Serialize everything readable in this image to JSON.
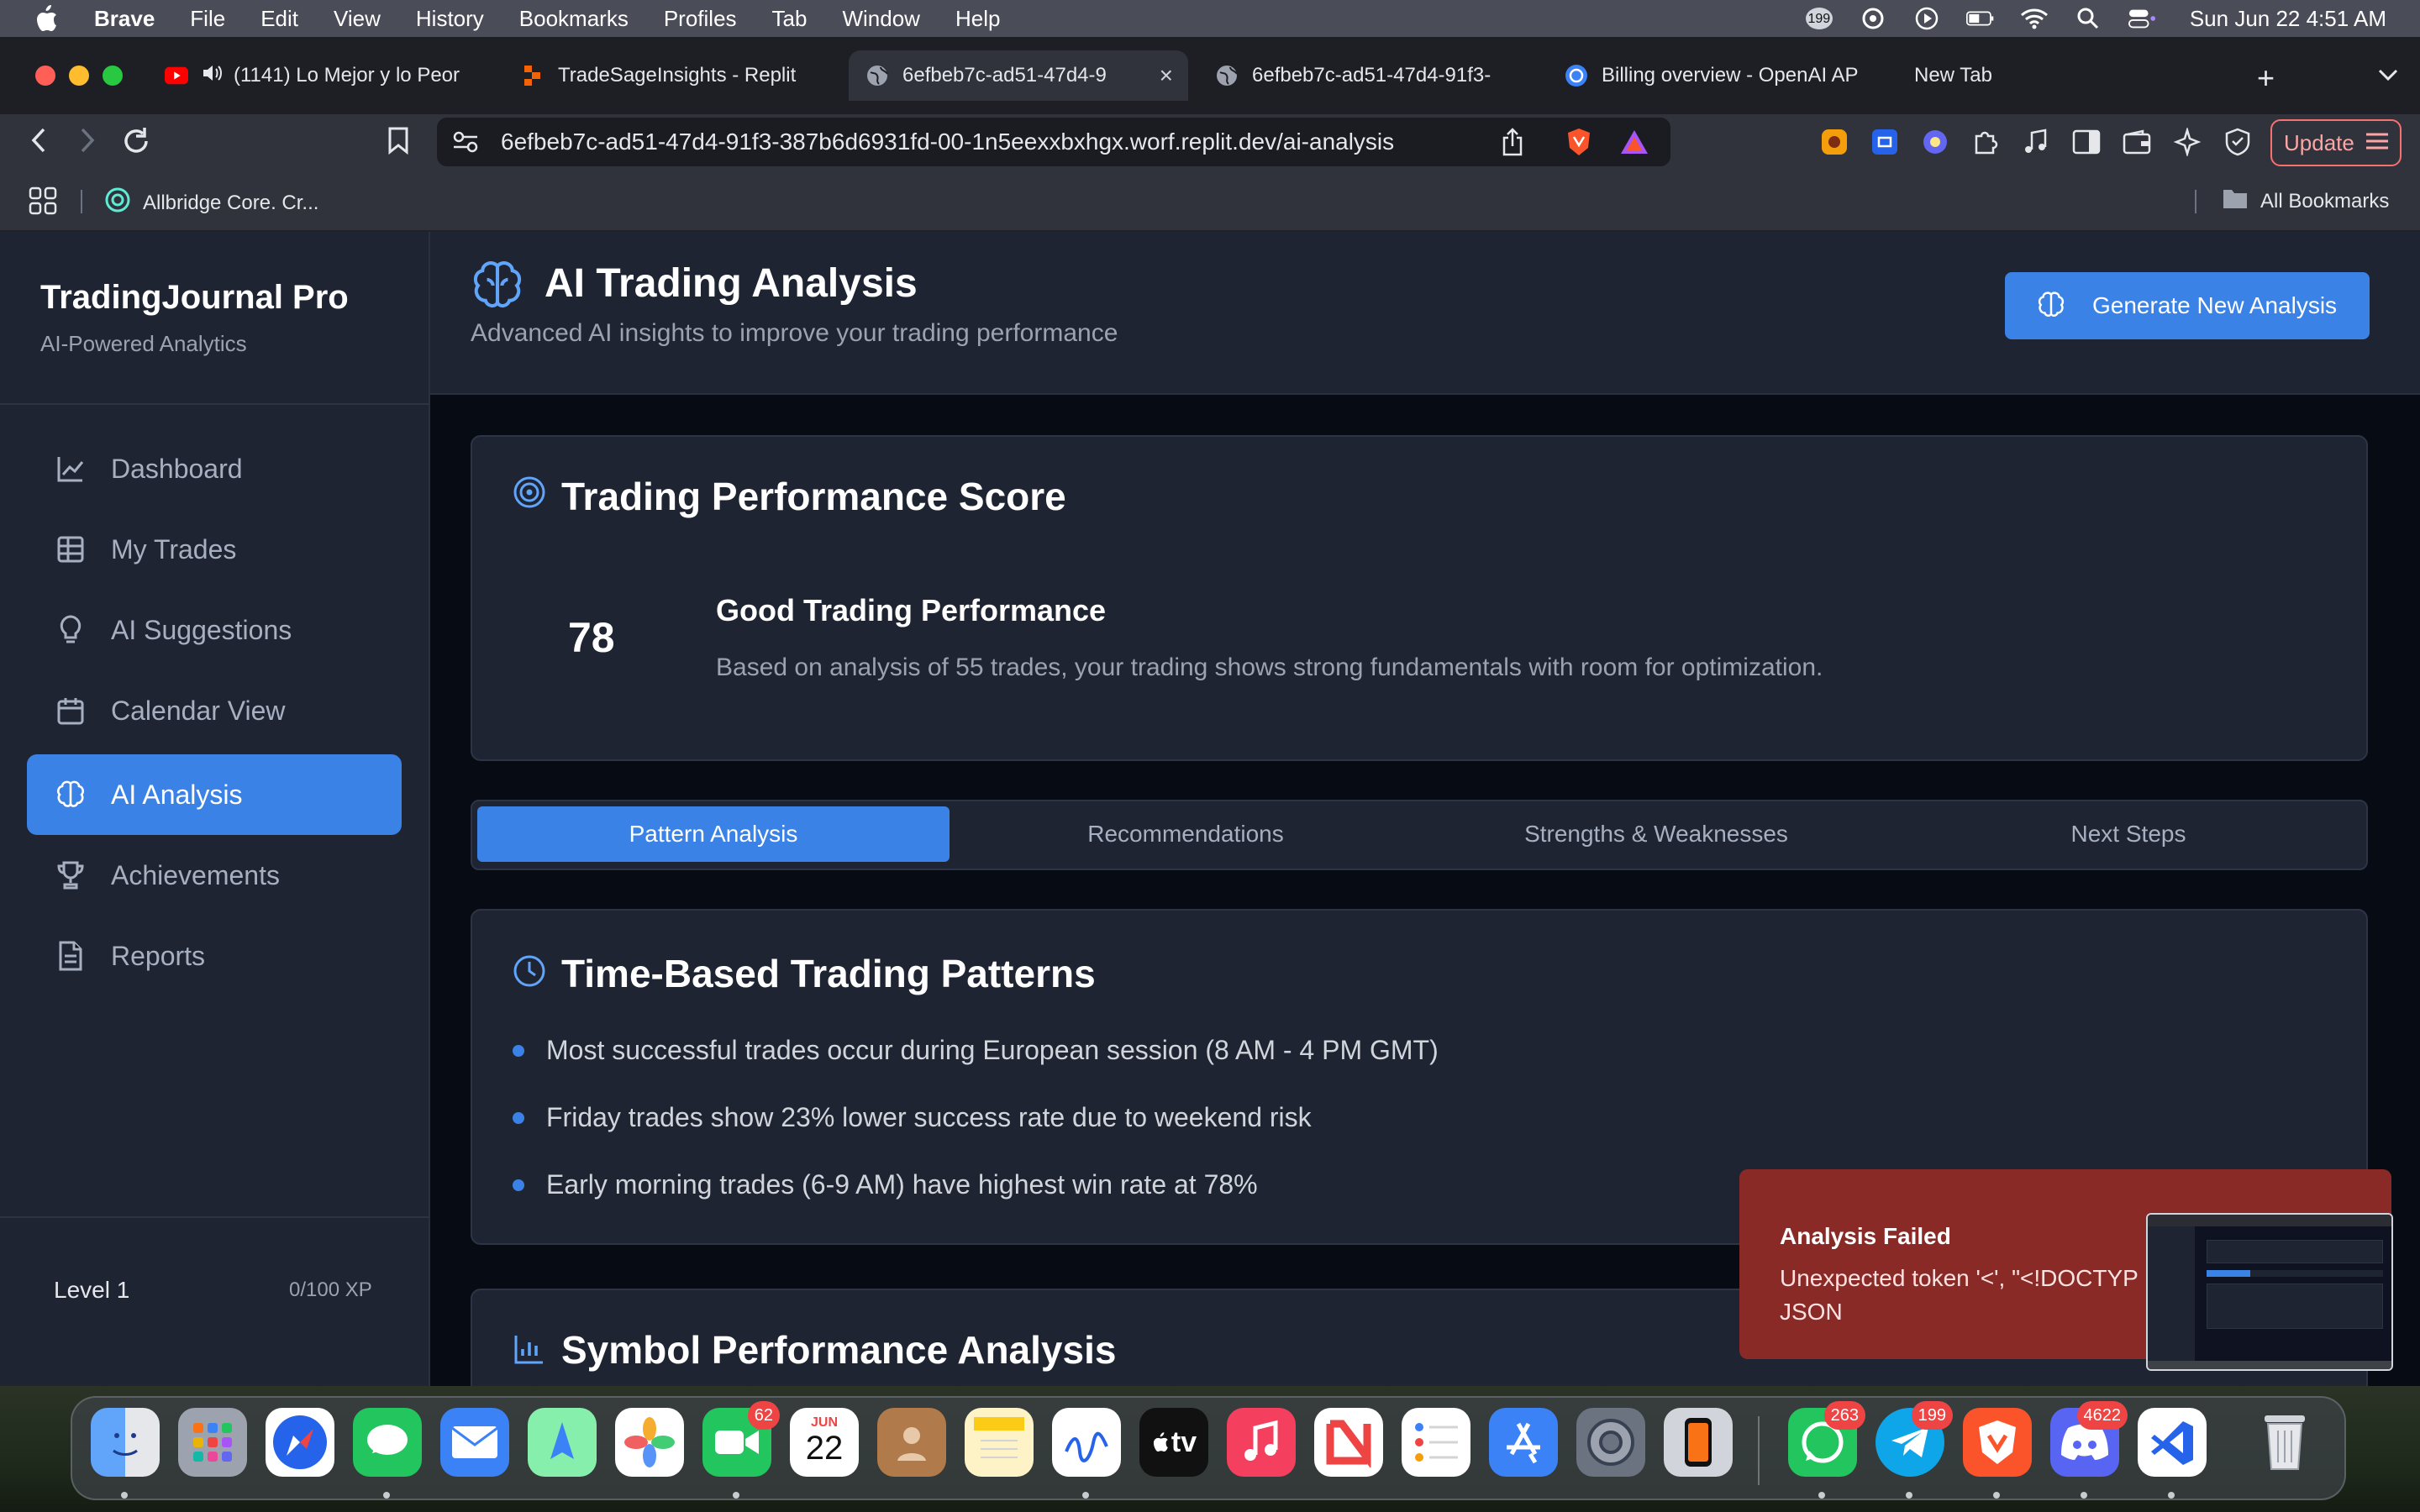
{
  "menubar": {
    "app_name": "Brave",
    "menus": [
      "File",
      "Edit",
      "View",
      "History",
      "Bookmarks",
      "Profiles",
      "Tab",
      "Window",
      "Help"
    ],
    "notif_count": "199",
    "clock": "Sun Jun 22  4:51 AM"
  },
  "browser": {
    "tabs": [
      {
        "title": "(1141) Lo Mejor y lo Peor",
        "icon": "youtube-icon"
      },
      {
        "title": "TradeSageInsights - Replit",
        "icon": "replit-icon"
      },
      {
        "title": "6efbeb7c-ad51-47d4-9",
        "icon": "globe-icon",
        "active": true
      },
      {
        "title": "6efbeb7c-ad51-47d4-91f3-",
        "icon": "globe-icon"
      },
      {
        "title": "Billing overview - OpenAI AP",
        "icon": "openai-icon"
      },
      {
        "title": "New Tab",
        "icon": ""
      }
    ],
    "url": "6efbeb7c-ad51-47d4-91f3-387b6d6931fd-00-1n5eexxbxhgx.worf.replit.dev/ai-analysis",
    "update_label": "Update",
    "bookmark_folder": "Allbridge Core. Cr...",
    "all_bookmarks": "All Bookmarks"
  },
  "sidebar": {
    "brand": "TradingJournal Pro",
    "subtitle": "AI-Powered Analytics",
    "items": [
      {
        "label": "Dashboard",
        "icon": "chart-line-icon"
      },
      {
        "label": "My Trades",
        "icon": "table-icon"
      },
      {
        "label": "AI Suggestions",
        "icon": "lightbulb-icon"
      },
      {
        "label": "Calendar View",
        "icon": "calendar-icon"
      },
      {
        "label": "AI Analysis",
        "icon": "brain-icon",
        "active": true
      },
      {
        "label": "Achievements",
        "icon": "trophy-icon"
      },
      {
        "label": "Reports",
        "icon": "document-icon"
      }
    ],
    "level": "Level 1",
    "xp": "0/100 XP"
  },
  "header": {
    "title": "AI Trading Analysis",
    "subtitle": "Advanced AI insights to improve your trading performance",
    "generate_label": "Generate New Analysis"
  },
  "score_card": {
    "title": "Trading Performance Score",
    "score": "78",
    "heading": "Good Trading Performance",
    "description": "Based on analysis of 55 trades, your trading shows strong fundamentals with room for optimization."
  },
  "tabs": [
    "Pattern Analysis",
    "Recommendations",
    "Strengths & Weaknesses",
    "Next Steps"
  ],
  "time_patterns": {
    "title": "Time-Based Trading Patterns",
    "items": [
      "Most successful trades occur during European session (8 AM - 4 PM GMT)",
      "Friday trades show 23% lower success rate due to weekend risk",
      "Early morning trades (6-9 AM) have highest win rate at 78%"
    ]
  },
  "symbol_card": {
    "title": "Symbol Performance Analysis"
  },
  "toast": {
    "title": "Analysis Failed",
    "message": "Unexpected token '<', \"<!DOCTYP\nJSON"
  },
  "dock": {
    "facetime_badge": "62",
    "calendar_month": "JUN",
    "calendar_day": "22",
    "whatsapp_badge": "263",
    "telegram_badge": "199",
    "discord_badge": "4622",
    "appletv_label": "tv"
  },
  "colors": {
    "accent": "#3b82e6",
    "panel": "#1f2432",
    "background": "#070b14",
    "toast": "#8a2a27"
  }
}
